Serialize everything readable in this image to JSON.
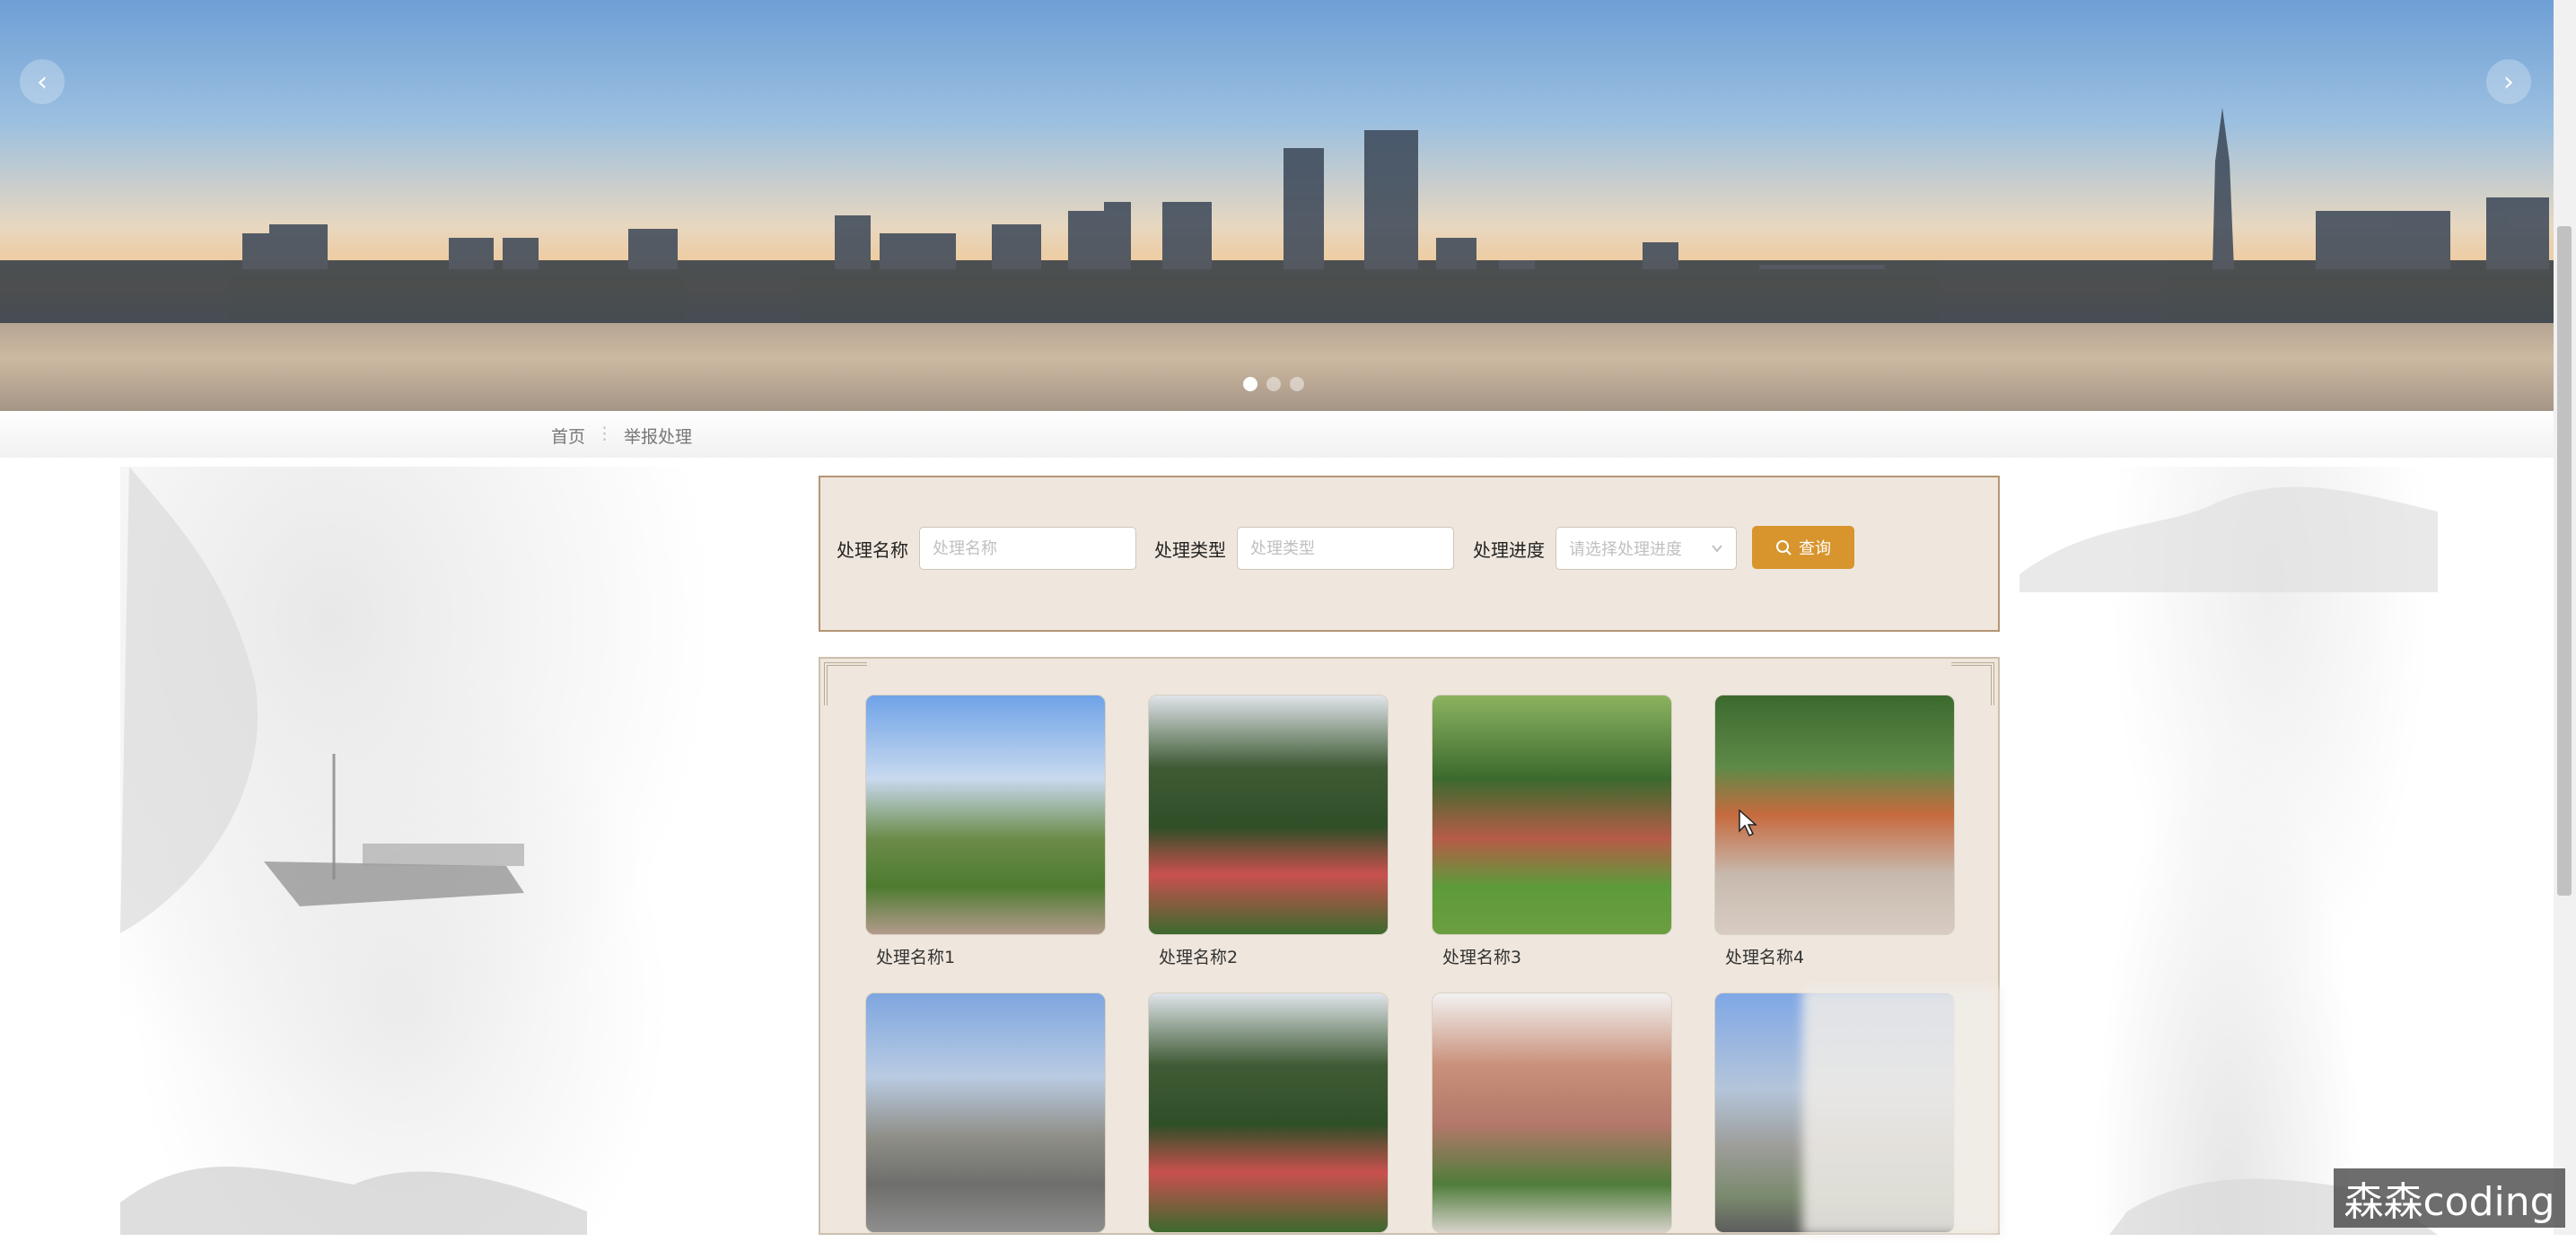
{
  "banner": {
    "prev_icon": "chevron-left-icon",
    "next_icon": "chevron-right-icon",
    "prev_glyph": "‹",
    "next_glyph": "›",
    "dots": 3,
    "active_dot": 0
  },
  "breadcrumb": {
    "home": "首页",
    "separator": "⋮",
    "current": "举报处理"
  },
  "search": {
    "name_label": "处理名称",
    "name_placeholder": "处理名称",
    "type_label": "处理类型",
    "type_placeholder": "处理类型",
    "progress_label": "处理进度",
    "progress_placeholder": "请选择处理进度",
    "query_button": "查询",
    "accent_color": "#d8952e"
  },
  "cards": [
    {
      "name": "处理名称1"
    },
    {
      "name": "处理名称2"
    },
    {
      "name": "处理名称3"
    },
    {
      "name": "处理名称4"
    },
    {
      "name": ""
    },
    {
      "name": ""
    },
    {
      "name": ""
    },
    {
      "name": ""
    }
  ],
  "watermark": "森森coding"
}
